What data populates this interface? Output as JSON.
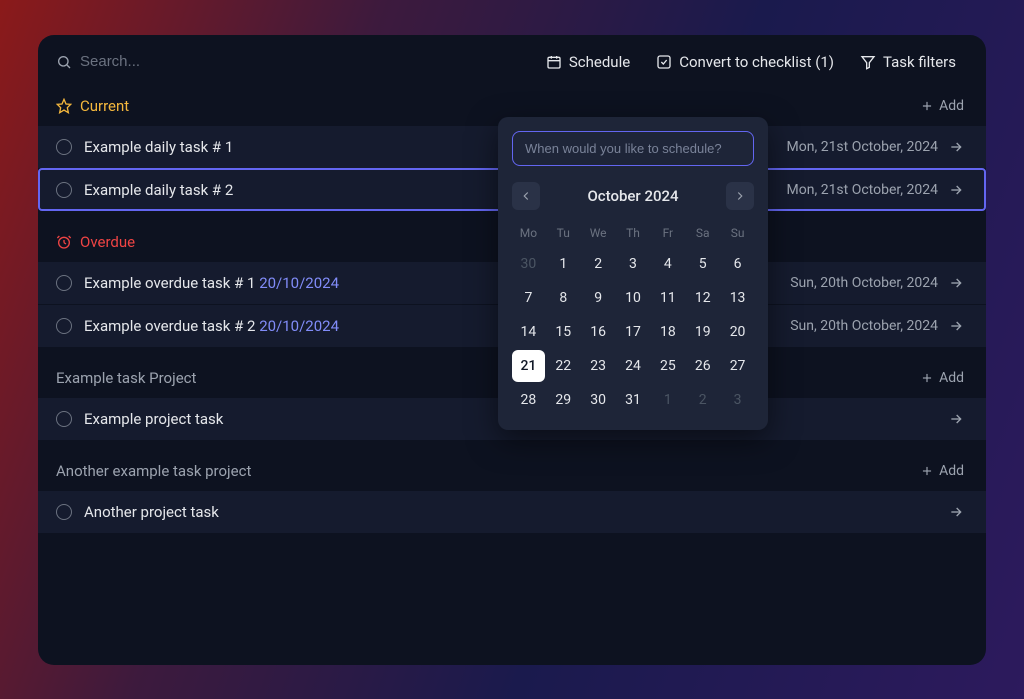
{
  "search": {
    "placeholder": "Search..."
  },
  "toolbar": {
    "schedule": "Schedule",
    "convert": "Convert to checklist (1)",
    "filters": "Task filters"
  },
  "sections": {
    "current": {
      "label": "Current",
      "add": "Add",
      "tasks": [
        {
          "title": "Example daily task # 1",
          "date": "Mon, 21st October, 2024",
          "selected": false
        },
        {
          "title": "Example daily task # 2",
          "date": "Mon, 21st October, 2024",
          "selected": true
        }
      ]
    },
    "overdue": {
      "label": "Overdue",
      "tasks": [
        {
          "title": "Example overdue task # 1 ",
          "inline_date": "20/10/2024",
          "date": "Sun, 20th October, 2024"
        },
        {
          "title": "Example overdue task # 2 ",
          "inline_date": "20/10/2024",
          "date": "Sun, 20th October, 2024"
        }
      ]
    },
    "project1": {
      "label": "Example task Project",
      "add": "Add",
      "tasks": [
        {
          "title": "Example project task"
        }
      ]
    },
    "project2": {
      "label": "Another example task project",
      "add": "Add",
      "tasks": [
        {
          "title": "Another project task"
        }
      ]
    }
  },
  "datepicker": {
    "placeholder": "When would you like to schedule?",
    "month_label": "October 2024",
    "dow": [
      "Mo",
      "Tu",
      "We",
      "Th",
      "Fr",
      "Sa",
      "Su"
    ],
    "weeks": [
      [
        {
          "n": "30",
          "out": true
        },
        {
          "n": "1"
        },
        {
          "n": "2"
        },
        {
          "n": "3"
        },
        {
          "n": "4"
        },
        {
          "n": "5"
        },
        {
          "n": "6"
        }
      ],
      [
        {
          "n": "7"
        },
        {
          "n": "8"
        },
        {
          "n": "9"
        },
        {
          "n": "10"
        },
        {
          "n": "11"
        },
        {
          "n": "12"
        },
        {
          "n": "13"
        }
      ],
      [
        {
          "n": "14"
        },
        {
          "n": "15"
        },
        {
          "n": "16"
        },
        {
          "n": "17"
        },
        {
          "n": "18"
        },
        {
          "n": "19"
        },
        {
          "n": "20"
        }
      ],
      [
        {
          "n": "21",
          "today": true
        },
        {
          "n": "22"
        },
        {
          "n": "23"
        },
        {
          "n": "24"
        },
        {
          "n": "25"
        },
        {
          "n": "26"
        },
        {
          "n": "27"
        }
      ],
      [
        {
          "n": "28"
        },
        {
          "n": "29"
        },
        {
          "n": "30"
        },
        {
          "n": "31"
        },
        {
          "n": "1",
          "out": true
        },
        {
          "n": "2",
          "out": true
        },
        {
          "n": "3",
          "out": true
        }
      ]
    ]
  }
}
